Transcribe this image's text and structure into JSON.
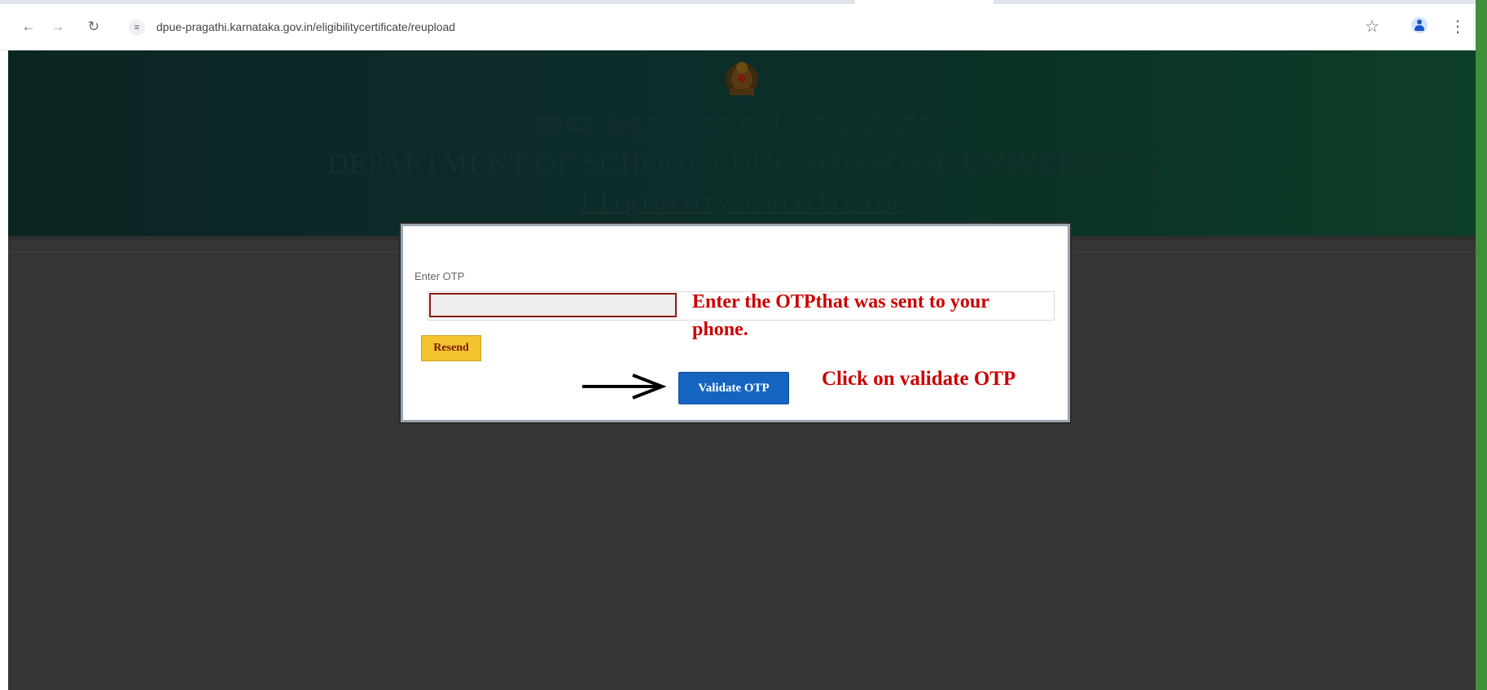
{
  "browser": {
    "url": "dpue-pragathi.karnataka.gov.in/eligibilitycertificate/reupload",
    "icons": {
      "back": "back-arrow-icon",
      "forward": "forward-arrow-icon",
      "reload": "reload-icon",
      "site_info": "site-settings-icon",
      "bookmark": "star-icon",
      "profile": "profile-icon",
      "menu": "kebab-menu-icon"
    }
  },
  "header": {
    "kannada_title": "ಶಾಲಾ ಶಿಕ್ಷಣ ಇಲಾಖೆ (ಪದವಿ ಪೂರ್ವ)",
    "department_title": "DEPARTMENT OF SCHOOL EDUCATION(PRE UNIVERSITY)",
    "subtitle": "Eligibility Certificate",
    "emblem_icon": "state-emblem-icon"
  },
  "otp_form": {
    "label": "Enter OTP",
    "input_value": "",
    "resend_label": "Resend",
    "validate_label": "Validate OTP"
  },
  "annotations": {
    "otp_instruction": "Enter the OTPthat was sent to your phone.",
    "validate_instruction": "Click on validate OTP",
    "arrow_icon": "right-arrow-icon",
    "color": "#cc0000"
  },
  "colors": {
    "header_green": "#0d3e27",
    "validate_button": "#1565c0",
    "resend_button": "#f4c430",
    "side_strip": "#3f8f3a"
  }
}
